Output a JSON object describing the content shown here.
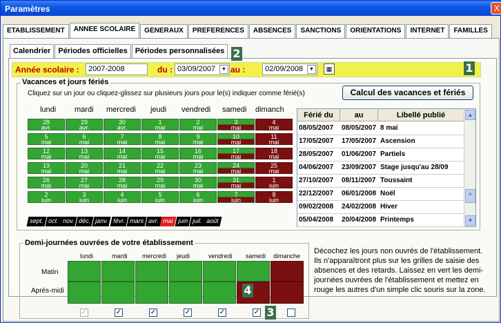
{
  "window": {
    "title": "Paramètres",
    "close": "X"
  },
  "main_tabs": [
    "ETABLISSEMENT",
    "ANNEE SCOLAIRE",
    "GENERAUX",
    "PREFERENCES",
    "ABSENCES",
    "SANCTIONS",
    "ORIENTATIONS",
    "INTERNET",
    "FAMILLES"
  ],
  "sub_tabs": [
    "Calendrier",
    "Périodes officielles",
    "Périodes personnalisées"
  ],
  "badges": {
    "b1": "1",
    "b2": "2",
    "b3": "3",
    "b4": "4"
  },
  "year": {
    "label": "Année scolaire :",
    "value": "2007-2008",
    "from_label": "du :",
    "from": "03/09/2007",
    "to_label": "au :",
    "to": "02/09/2008"
  },
  "vacances": {
    "title": "Vacances et jours fériés",
    "hint": "Cliquez sur un jour ou cliquez-glissez sur plusieurs jours pour le(s) indiquer comme férié(s)",
    "calc_button": "Calcul des vacances et fériés"
  },
  "days": [
    "lundi",
    "mardi",
    "mercredi",
    "jeudi",
    "vendredi",
    "samedi",
    "dimanch"
  ],
  "calendar": [
    [
      [
        "28",
        "avr.",
        "g"
      ],
      [
        "29",
        "avr.",
        "g"
      ],
      [
        "30",
        "avr.",
        "g"
      ],
      [
        "1",
        "mai",
        "g"
      ],
      [
        "2",
        "mai",
        "g"
      ],
      [
        "3",
        "mai",
        "h"
      ],
      [
        "4",
        "mai",
        "r"
      ]
    ],
    [
      [
        "5",
        "mai",
        "g"
      ],
      [
        "6",
        "mai",
        "g"
      ],
      [
        "7",
        "mai",
        "g"
      ],
      [
        "8",
        "mai",
        "g"
      ],
      [
        "9",
        "mai",
        "g"
      ],
      [
        "10",
        "mai",
        "h"
      ],
      [
        "11",
        "mai",
        "r"
      ]
    ],
    [
      [
        "12",
        "mai",
        "g"
      ],
      [
        "13",
        "mai",
        "g"
      ],
      [
        "14",
        "mai",
        "g"
      ],
      [
        "15",
        "mai",
        "g"
      ],
      [
        "16",
        "mai",
        "g"
      ],
      [
        "17",
        "mai",
        "h"
      ],
      [
        "18",
        "mai",
        "r"
      ]
    ],
    [
      [
        "19",
        "mai",
        "g"
      ],
      [
        "20",
        "mai",
        "g"
      ],
      [
        "21",
        "mai",
        "g"
      ],
      [
        "22",
        "mai",
        "g"
      ],
      [
        "23",
        "mai",
        "g"
      ],
      [
        "24",
        "mai",
        "h"
      ],
      [
        "25",
        "mai",
        "r"
      ]
    ],
    [
      [
        "26",
        "mai",
        "g"
      ],
      [
        "27",
        "mai",
        "g"
      ],
      [
        "28",
        "mai",
        "g"
      ],
      [
        "29",
        "mai",
        "g"
      ],
      [
        "30",
        "mai",
        "g"
      ],
      [
        "31",
        "mai",
        "h"
      ],
      [
        "1",
        "juin",
        "r"
      ]
    ],
    [
      [
        "2",
        "juin",
        "g"
      ],
      [
        "3",
        "juin",
        "g"
      ],
      [
        "4",
        "juin",
        "g"
      ],
      [
        "5",
        "juin",
        "g"
      ],
      [
        "6",
        "juin",
        "g"
      ],
      [
        "7",
        "juin",
        "h"
      ],
      [
        "8",
        "juin",
        "r"
      ]
    ]
  ],
  "months": [
    [
      "sept.",
      false
    ],
    [
      "oct.",
      false
    ],
    [
      "nov.",
      false
    ],
    [
      "déc.",
      false
    ],
    [
      "janv.",
      false
    ],
    [
      "févr.",
      false
    ],
    [
      "mars",
      false
    ],
    [
      "avr.",
      false
    ],
    [
      "mai",
      true
    ],
    [
      "juin",
      false
    ],
    [
      "juil.",
      false
    ],
    [
      "août",
      false
    ]
  ],
  "ferie_table": {
    "headers": [
      "Férié du",
      "au",
      "Libellé publié"
    ],
    "rows": [
      [
        "08/05/2007",
        "08/05/2007",
        "8 mai"
      ],
      [
        "17/05/2007",
        "17/05/2007",
        "Ascension"
      ],
      [
        "28/05/2007",
        "01/06/2007",
        "Partiels"
      ],
      [
        "04/06/2007",
        "23/09/2007",
        "Stage jusqu'au 28/09"
      ],
      [
        "27/10/2007",
        "08/11/2007",
        "Toussaint"
      ],
      [
        "22/12/2007",
        "06/01/2008",
        "Noël"
      ],
      [
        "09/02/2008",
        "24/02/2008",
        "Hiver"
      ],
      [
        "05/04/2008",
        "20/04/2008",
        "Printemps"
      ]
    ]
  },
  "demi": {
    "title": "Demi-journées ouvrées de votre établissement",
    "cols": [
      "lundi",
      "mardi",
      "mercredi",
      "jeudi",
      "vendredi",
      "samedi",
      "dimanche"
    ],
    "rows": [
      "Matin",
      "Après-midi"
    ],
    "matin": [
      "g",
      "g",
      "g",
      "g",
      "g",
      "g",
      "r"
    ],
    "apres": [
      "g",
      "g",
      "g",
      "g",
      "g",
      "r",
      "r"
    ],
    "checks": [
      "✓",
      "✓",
      "✓",
      "✓",
      "✓",
      "✓",
      ""
    ],
    "note": "Décochez les jours non ouvrés de l'établissement. Ils n'apparaîtront plus sur les grilles de saisie des absences et des retards. Laissez en vert les demi-journées ouvrées de l'établissement et mettez en rouge les autres d'un simple clic souris sur la zone."
  },
  "colors": {
    "green": "#33a533",
    "red": "#7a1010",
    "yellow": "#f1f14a"
  }
}
